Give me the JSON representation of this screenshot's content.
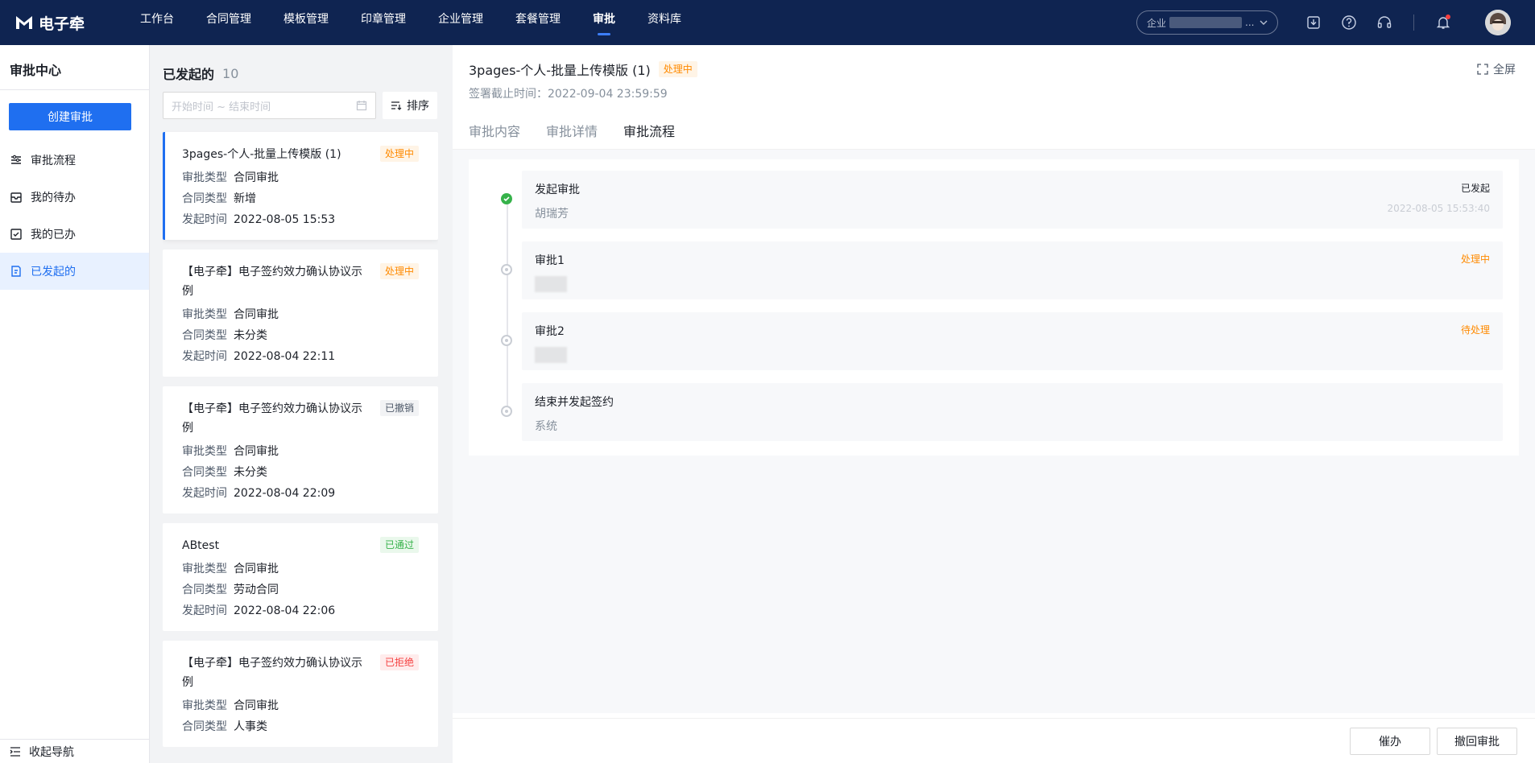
{
  "app": {
    "name": "电子牵"
  },
  "nav": [
    {
      "label": "工作台"
    },
    {
      "label": "合同管理"
    },
    {
      "label": "模板管理"
    },
    {
      "label": "印章管理"
    },
    {
      "label": "企业管理"
    },
    {
      "label": "套餐管理"
    },
    {
      "label": "审批"
    },
    {
      "label": "资料库"
    }
  ],
  "enterprise": {
    "prefix": "企业",
    "suffix": "..."
  },
  "sidebar": {
    "title": "审批中心",
    "create_label": "创建审批",
    "items": [
      {
        "label": "审批流程"
      },
      {
        "label": "我的待办"
      },
      {
        "label": "我的已办"
      },
      {
        "label": "已发起的"
      }
    ],
    "collapse_label": "收起导航"
  },
  "list": {
    "title": "已发起的",
    "count": "10",
    "date_placeholder": "开始时间 ~ 结束时间",
    "sort_label": "排序",
    "field_labels": {
      "approval_type": "审批类型",
      "contract_type": "合同类型",
      "start_time": "发起时间"
    },
    "cards": [
      {
        "title": "3pages-个人-批量上传模版 (1)",
        "status": "处理中",
        "approval_type": "合同审批",
        "contract_type": "新增",
        "start_time": "2022-08-05 15:53"
      },
      {
        "title": "【电子牵】电子签约效力确认协议示例",
        "status": "处理中",
        "approval_type": "合同审批",
        "contract_type": "未分类",
        "start_time": "2022-08-04 22:11"
      },
      {
        "title": "【电子牵】电子签约效力确认协议示例",
        "status": "已撤销",
        "approval_type": "合同审批",
        "contract_type": "未分类",
        "start_time": "2022-08-04 22:09"
      },
      {
        "title": "ABtest",
        "status": "已通过",
        "approval_type": "合同审批",
        "contract_type": "劳动合同",
        "start_time": "2022-08-04 22:06"
      },
      {
        "title": "【电子牵】电子签约效力确认协议示例",
        "status": "已拒绝",
        "approval_type": "合同审批",
        "contract_type": "人事类",
        "start_time": ""
      }
    ]
  },
  "detail": {
    "title": "3pages-个人-批量上传模版 (1)",
    "status": "处理中",
    "deadline_label": "签署截止时间：",
    "deadline": "2022-09-04 23:59:59",
    "fullscreen_label": "全屏",
    "tabs": [
      {
        "label": "审批内容"
      },
      {
        "label": "审批详情"
      },
      {
        "label": "审批流程"
      }
    ],
    "steps": [
      {
        "name": "发起审批",
        "user": "胡瑞芳",
        "status": "已发起",
        "time": "2022-08-05 15:53:40"
      },
      {
        "name": "审批1",
        "user": "",
        "status": "处理中",
        "time": ""
      },
      {
        "name": "审批2",
        "user": "",
        "status": "待处理",
        "time": ""
      },
      {
        "name": "结束并发起签约",
        "user": "系统",
        "status": "",
        "time": ""
      }
    ],
    "buttons": {
      "urge": "催办",
      "withdraw": "撤回审批"
    }
  },
  "colors": {
    "topbar": "#0f2451",
    "primary": "#1f6ff0",
    "warning": "#ff8a00",
    "success": "#36b24a",
    "danger": "#f53f3f"
  }
}
